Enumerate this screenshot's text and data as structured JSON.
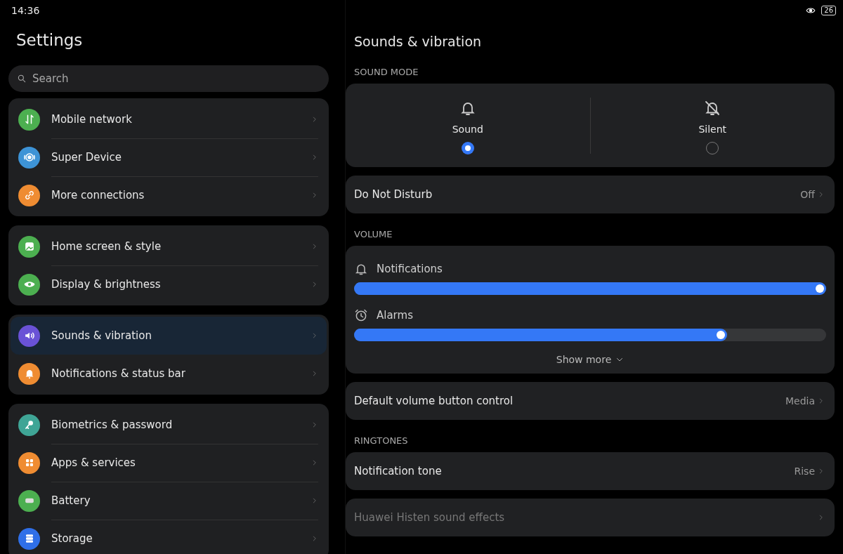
{
  "status_bar": {
    "time": "14:36",
    "battery": "26"
  },
  "sidebar": {
    "title": "Settings",
    "search": {
      "placeholder": "Search"
    },
    "groups": [
      {
        "items": [
          {
            "label": "Mobile network",
            "kind": "network",
            "color": "#4caf50",
            "selected": false
          },
          {
            "label": "Super Device",
            "kind": "device",
            "color": "#3d93d6",
            "selected": false
          },
          {
            "label": "More connections",
            "kind": "link",
            "color": "#ef8c32",
            "selected": false
          }
        ]
      },
      {
        "items": [
          {
            "label": "Home screen & style",
            "kind": "image",
            "color": "#4caf50",
            "selected": false
          },
          {
            "label": "Display & brightness",
            "kind": "eye",
            "color": "#4caf50",
            "selected": false
          }
        ]
      },
      {
        "items": [
          {
            "label": "Sounds & vibration",
            "kind": "speaker",
            "color": "#6a52d6",
            "selected": true
          },
          {
            "label": "Notifications & status bar",
            "kind": "bell",
            "color": "#ef8c32",
            "selected": false
          }
        ]
      },
      {
        "items": [
          {
            "label": "Biometrics & password",
            "kind": "key",
            "color": "#3fa596",
            "selected": false
          },
          {
            "label": "Apps & services",
            "kind": "apps",
            "color": "#ef8c32",
            "selected": false
          },
          {
            "label": "Battery",
            "kind": "battery",
            "color": "#4caf50",
            "selected": false
          },
          {
            "label": "Storage",
            "kind": "storage",
            "color": "#2f6fe8",
            "selected": false
          }
        ]
      }
    ]
  },
  "detail": {
    "title": "Sounds & vibration",
    "sections": [
      {
        "kind": "modes",
        "header": "SOUND MODE",
        "options": [
          {
            "label": "Sound",
            "kind": "bell",
            "selected": true
          },
          {
            "label": "Silent",
            "kind": "bell-off",
            "selected": false
          }
        ]
      },
      {
        "kind": "row",
        "label": "Do Not Disturb",
        "value": "Off",
        "disabled": false
      },
      {
        "kind": "volume",
        "header": "VOLUME",
        "sliders": [
          {
            "label": "Notifications",
            "kind": "bell",
            "level": 1.0
          },
          {
            "label": "Alarms",
            "kind": "clock",
            "level": 0.79
          }
        ],
        "more": "Show more"
      },
      {
        "kind": "row",
        "label": "Default volume button control",
        "value": "Media",
        "disabled": false
      },
      {
        "kind": "row",
        "header": "RINGTONES",
        "label": "Notification tone",
        "value": "Rise",
        "disabled": false
      },
      {
        "kind": "row",
        "label": "Huawei Histen sound effects",
        "disabled": true
      }
    ]
  }
}
